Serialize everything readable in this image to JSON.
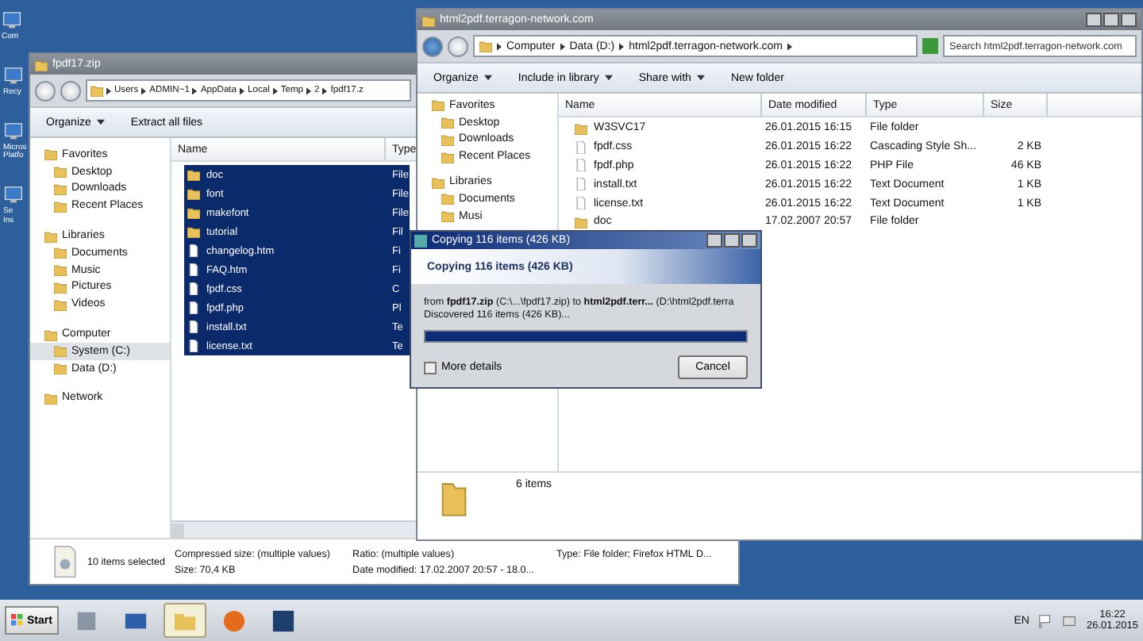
{
  "desktop_icons": [
    {
      "lines": [
        "Com"
      ]
    },
    {
      "lines": [
        "Recy"
      ]
    },
    {
      "lines": [
        "Micros",
        "Platfo"
      ]
    },
    {
      "lines": [
        "Se",
        "Ins"
      ]
    }
  ],
  "left_window": {
    "title": "fpdf17.zip",
    "address": [
      "Users",
      "ADMIN~1",
      "AppData",
      "Local",
      "Temp",
      "2",
      "fpdf17.z"
    ],
    "toolbar": [
      {
        "label": "Organize",
        "menu": true
      },
      {
        "label": "Extract all files",
        "menu": false
      }
    ],
    "nav": [
      {
        "label": "Favorites",
        "selected": false,
        "children": [
          {
            "label": "Desktop",
            "selected": false
          },
          {
            "label": "Downloads",
            "selected": false
          },
          {
            "label": "Recent Places",
            "selected": false
          }
        ]
      },
      {
        "label": "Libraries",
        "selected": false,
        "children": [
          {
            "label": "Documents",
            "selected": false
          },
          {
            "label": "Music",
            "selected": false
          },
          {
            "label": "Pictures",
            "selected": false
          },
          {
            "label": "Videos",
            "selected": false
          }
        ]
      },
      {
        "label": "Computer",
        "selected": false,
        "children": [
          {
            "label": "System (C:)",
            "selected": true
          },
          {
            "label": "Data (D:)",
            "selected": false
          }
        ]
      },
      {
        "label": "Network",
        "selected": false
      }
    ],
    "columns": [
      "Name",
      "Type"
    ],
    "rows": [
      {
        "name": "doc",
        "type": "File",
        "kind": "folder",
        "selected": true
      },
      {
        "name": "font",
        "type": "File",
        "kind": "folder",
        "selected": true
      },
      {
        "name": "makefont",
        "type": "File",
        "kind": "folder",
        "selected": true
      },
      {
        "name": "tutorial",
        "type": "Fil",
        "kind": "folder",
        "selected": true
      },
      {
        "name": "changelog.htm",
        "type": "Fi",
        "kind": "file",
        "selected": true
      },
      {
        "name": "FAQ.htm",
        "type": "Fi",
        "kind": "file",
        "selected": true
      },
      {
        "name": "fpdf.css",
        "type": "C",
        "kind": "file",
        "selected": true
      },
      {
        "name": "fpdf.php",
        "type": "Pl",
        "kind": "file",
        "selected": true
      },
      {
        "name": "install.txt",
        "type": "Te",
        "kind": "file",
        "selected": true
      },
      {
        "name": "license.txt",
        "type": "Te",
        "kind": "file",
        "selected": true
      }
    ],
    "status": {
      "selection": "10 items selected",
      "fields": [
        "Compressed size: (multiple values)",
        "Size: 70,4 KB",
        "Ratio: (multiple values)",
        "Date modified: 17.02.2007 20:57 - 18.0...",
        "Type: File folder; Firefox HTML D..."
      ]
    }
  },
  "right_window": {
    "title": "html2pdf.terragon-network.com",
    "address": [
      "Computer",
      "Data (D:)",
      "html2pdf.terragon-network.com"
    ],
    "search": {
      "placeholder": "Search html2pdf.terragon-network.com"
    },
    "toolbar": [
      {
        "label": "Organize",
        "menu": true
      },
      {
        "label": "Include in library",
        "menu": true
      },
      {
        "label": "Share with",
        "menu": true
      },
      {
        "label": "New folder",
        "menu": false
      }
    ],
    "nav": [
      {
        "label": "Favorites",
        "selected": false,
        "children": [
          {
            "label": "Desktop",
            "selected": false
          },
          {
            "label": "Downloads",
            "selected": false
          },
          {
            "label": "Recent Places",
            "selected": false
          }
        ]
      },
      {
        "label": "Libraries",
        "selected": false,
        "children": [
          {
            "label": "Documents",
            "selected": false
          },
          {
            "label": "Musi",
            "selected": false
          }
        ]
      }
    ],
    "columns": [
      "Name",
      "Date modified",
      "Type",
      "Size"
    ],
    "rows": [
      {
        "name": "W3SVC17",
        "date": "26.01.2015 16:15",
        "type": "File folder",
        "size": "",
        "kind": "folder"
      },
      {
        "name": "fpdf.css",
        "date": "26.01.2015 16:22",
        "type": "Cascading Style Sh...",
        "size": "2 KB",
        "kind": "file"
      },
      {
        "name": "fpdf.php",
        "date": "26.01.2015 16:22",
        "type": "PHP File",
        "size": "46 KB",
        "kind": "file"
      },
      {
        "name": "install.txt",
        "date": "26.01.2015 16:22",
        "type": "Text Document",
        "size": "1 KB",
        "kind": "file"
      },
      {
        "name": "license.txt",
        "date": "26.01.2015 16:22",
        "type": "Text Document",
        "size": "1 KB",
        "kind": "file"
      },
      {
        "name": "doc",
        "date": "17.02.2007 20:57",
        "type": "File folder",
        "size": "",
        "kind": "folder"
      }
    ],
    "details": "6 items"
  },
  "dialog": {
    "title": "Copying 116 items (426 KB)",
    "heading": "Copying 116 items (426 KB)",
    "from": "from **fpdf17.zip** (C:\\...\\fpdf17.zip) to **html2pdf.terr...** (D:\\html2pdf.terra",
    "discovered": "Discovered 116 items (426 KB)...",
    "progress": {
      "level": 1
    },
    "more_details": "More details",
    "cancel": "Cancel"
  },
  "taskbar": {
    "start": "Start",
    "apps": [
      {
        "selected": false
      },
      {
        "selected": false
      },
      {
        "selected": true
      },
      {
        "selected": false
      },
      {
        "selected": false
      }
    ],
    "language": "EN",
    "time": "16:22",
    "date": "26.01.2015"
  }
}
